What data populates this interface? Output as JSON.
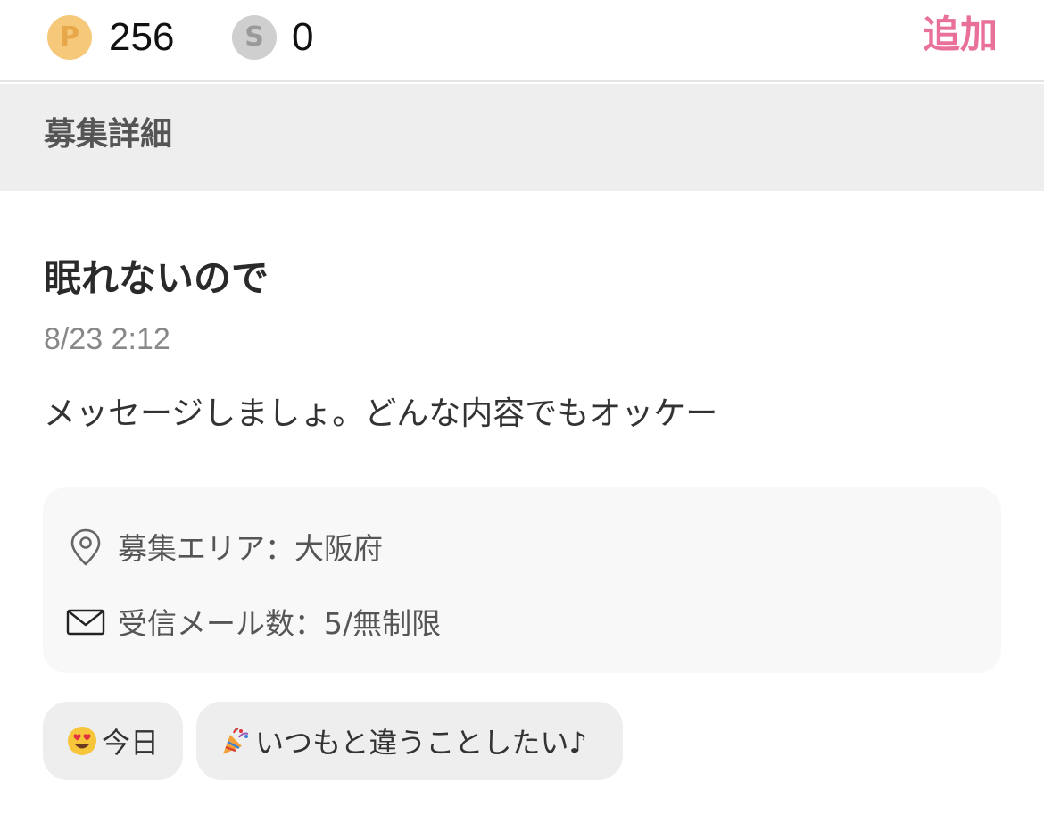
{
  "topbar": {
    "points_icon": "P",
    "points_value": "256",
    "s_icon": "S",
    "s_value": "0",
    "add_label": "追加"
  },
  "section": {
    "title": "募集詳細"
  },
  "post": {
    "title": "眠れないので",
    "date": "8/23 2:12",
    "body": "メッセージしましょ。どんな内容でもオッケー"
  },
  "info": {
    "area_text": "募集エリア：大阪府",
    "area_icon": "location-pin-icon",
    "mail_text": "受信メール数：5/無制限",
    "mail_icon": "envelope-icon"
  },
  "tags": [
    {
      "emoji": "heart-eyes-emoji",
      "label": "今日"
    },
    {
      "emoji": "party-popper-emoji",
      "label": "いつもと違うことしたい♪"
    }
  ],
  "colors": {
    "accent": "#e8709a",
    "points_coin": "#f5c87a",
    "s_coin": "#cfcfcf",
    "section_bg": "#eeeeee",
    "card_bg": "#f8f8f8"
  }
}
